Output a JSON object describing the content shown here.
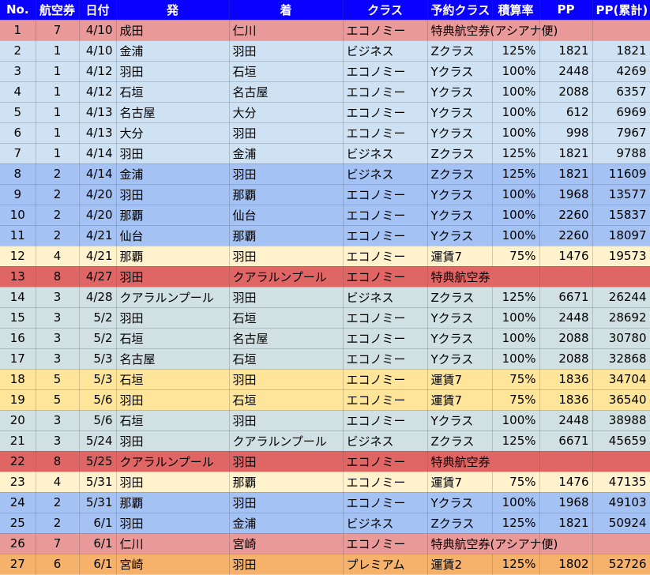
{
  "headers": [
    "No.",
    "航空券",
    "日付",
    "発",
    "着",
    "クラス",
    "予約クラス",
    "積算率",
    "PP",
    "PP(累計)"
  ],
  "colors": {
    "header": "#0a00ff",
    "t1": "#cfe2f3",
    "t2": "#a4c2f4",
    "t3": "#d0e0e3",
    "t4": "#fff2cc",
    "t5": "#ffe599",
    "t6": "#f6b26b",
    "t7": "#ea9999",
    "t8": "#e06666"
  },
  "rows": [
    {
      "no": "1",
      "ticket": "7",
      "date": "4/10",
      "from": "成田",
      "to": "仁川",
      "class": "エコノミー",
      "booking": "特典航空券(アシアナ便)",
      "rate": "",
      "pp": "",
      "cum": ""
    },
    {
      "no": "2",
      "ticket": "1",
      "date": "4/10",
      "from": "金浦",
      "to": "羽田",
      "class": "ビジネス",
      "booking": "Zクラス",
      "rate": "125%",
      "pp": "1821",
      "cum": "1821"
    },
    {
      "no": "3",
      "ticket": "1",
      "date": "4/12",
      "from": "羽田",
      "to": "石垣",
      "class": "エコノミー",
      "booking": "Yクラス",
      "rate": "100%",
      "pp": "2448",
      "cum": "4269"
    },
    {
      "no": "4",
      "ticket": "1",
      "date": "4/12",
      "from": "石垣",
      "to": "名古屋",
      "class": "エコノミー",
      "booking": "Yクラス",
      "rate": "100%",
      "pp": "2088",
      "cum": "6357"
    },
    {
      "no": "5",
      "ticket": "1",
      "date": "4/13",
      "from": "名古屋",
      "to": "大分",
      "class": "エコノミー",
      "booking": "Yクラス",
      "rate": "100%",
      "pp": "612",
      "cum": "6969"
    },
    {
      "no": "6",
      "ticket": "1",
      "date": "4/13",
      "from": "大分",
      "to": "羽田",
      "class": "エコノミー",
      "booking": "Yクラス",
      "rate": "100%",
      "pp": "998",
      "cum": "7967"
    },
    {
      "no": "7",
      "ticket": "1",
      "date": "4/14",
      "from": "羽田",
      "to": "金浦",
      "class": "ビジネス",
      "booking": "Zクラス",
      "rate": "125%",
      "pp": "1821",
      "cum": "9788"
    },
    {
      "no": "8",
      "ticket": "2",
      "date": "4/14",
      "from": "金浦",
      "to": "羽田",
      "class": "ビジネス",
      "booking": "Zクラス",
      "rate": "125%",
      "pp": "1821",
      "cum": "11609"
    },
    {
      "no": "9",
      "ticket": "2",
      "date": "4/20",
      "from": "羽田",
      "to": "那覇",
      "class": "エコノミー",
      "booking": "Yクラス",
      "rate": "100%",
      "pp": "1968",
      "cum": "13577"
    },
    {
      "no": "10",
      "ticket": "2",
      "date": "4/20",
      "from": "那覇",
      "to": "仙台",
      "class": "エコノミー",
      "booking": "Yクラス",
      "rate": "100%",
      "pp": "2260",
      "cum": "15837"
    },
    {
      "no": "11",
      "ticket": "2",
      "date": "4/21",
      "from": "仙台",
      "to": "那覇",
      "class": "エコノミー",
      "booking": "Yクラス",
      "rate": "100%",
      "pp": "2260",
      "cum": "18097"
    },
    {
      "no": "12",
      "ticket": "4",
      "date": "4/21",
      "from": "那覇",
      "to": "羽田",
      "class": "エコノミー",
      "booking": "運賃7",
      "rate": "75%",
      "pp": "1476",
      "cum": "19573"
    },
    {
      "no": "13",
      "ticket": "8",
      "date": "4/27",
      "from": "羽田",
      "to": "クアラルンプール",
      "class": "エコノミー",
      "booking": "特典航空券",
      "rate": "",
      "pp": "",
      "cum": ""
    },
    {
      "no": "14",
      "ticket": "3",
      "date": "4/28",
      "from": "クアラルンプール",
      "to": "羽田",
      "class": "ビジネス",
      "booking": "Zクラス",
      "rate": "125%",
      "pp": "6671",
      "cum": "26244"
    },
    {
      "no": "15",
      "ticket": "3",
      "date": "5/2",
      "from": "羽田",
      "to": "石垣",
      "class": "エコノミー",
      "booking": "Yクラス",
      "rate": "100%",
      "pp": "2448",
      "cum": "28692"
    },
    {
      "no": "16",
      "ticket": "3",
      "date": "5/2",
      "from": "石垣",
      "to": "名古屋",
      "class": "エコノミー",
      "booking": "Yクラス",
      "rate": "100%",
      "pp": "2088",
      "cum": "30780"
    },
    {
      "no": "17",
      "ticket": "3",
      "date": "5/3",
      "from": "名古屋",
      "to": "石垣",
      "class": "エコノミー",
      "booking": "Yクラス",
      "rate": "100%",
      "pp": "2088",
      "cum": "32868"
    },
    {
      "no": "18",
      "ticket": "5",
      "date": "5/3",
      "from": "石垣",
      "to": "羽田",
      "class": "エコノミー",
      "booking": "運賃7",
      "rate": "75%",
      "pp": "1836",
      "cum": "34704"
    },
    {
      "no": "19",
      "ticket": "5",
      "date": "5/6",
      "from": "羽田",
      "to": "石垣",
      "class": "エコノミー",
      "booking": "運賃7",
      "rate": "75%",
      "pp": "1836",
      "cum": "36540"
    },
    {
      "no": "20",
      "ticket": "3",
      "date": "5/6",
      "from": "石垣",
      "to": "羽田",
      "class": "エコノミー",
      "booking": "Yクラス",
      "rate": "100%",
      "pp": "2448",
      "cum": "38988"
    },
    {
      "no": "21",
      "ticket": "3",
      "date": "5/24",
      "from": "羽田",
      "to": "クアラルンプール",
      "class": "ビジネス",
      "booking": "Zクラス",
      "rate": "125%",
      "pp": "6671",
      "cum": "45659"
    },
    {
      "no": "22",
      "ticket": "8",
      "date": "5/25",
      "from": "クアラルンプール",
      "to": "羽田",
      "class": "エコノミー",
      "booking": "特典航空券",
      "rate": "",
      "pp": "",
      "cum": ""
    },
    {
      "no": "23",
      "ticket": "4",
      "date": "5/31",
      "from": "羽田",
      "to": "那覇",
      "class": "エコノミー",
      "booking": "運賃7",
      "rate": "75%",
      "pp": "1476",
      "cum": "47135"
    },
    {
      "no": "24",
      "ticket": "2",
      "date": "5/31",
      "from": "那覇",
      "to": "羽田",
      "class": "エコノミー",
      "booking": "Yクラス",
      "rate": "100%",
      "pp": "1968",
      "cum": "49103"
    },
    {
      "no": "25",
      "ticket": "2",
      "date": "6/1",
      "from": "羽田",
      "to": "金浦",
      "class": "ビジネス",
      "booking": "Zクラス",
      "rate": "125%",
      "pp": "1821",
      "cum": "50924"
    },
    {
      "no": "26",
      "ticket": "7",
      "date": "6/1",
      "from": "仁川",
      "to": "宮崎",
      "class": "エコノミー",
      "booking": "特典航空券(アシアナ便)",
      "rate": "",
      "pp": "",
      "cum": ""
    },
    {
      "no": "27",
      "ticket": "6",
      "date": "6/1",
      "from": "宮崎",
      "to": "羽田",
      "class": "プレミアム",
      "booking": "運賃2",
      "rate": "125%",
      "pp": "1802",
      "cum": "52726"
    }
  ]
}
